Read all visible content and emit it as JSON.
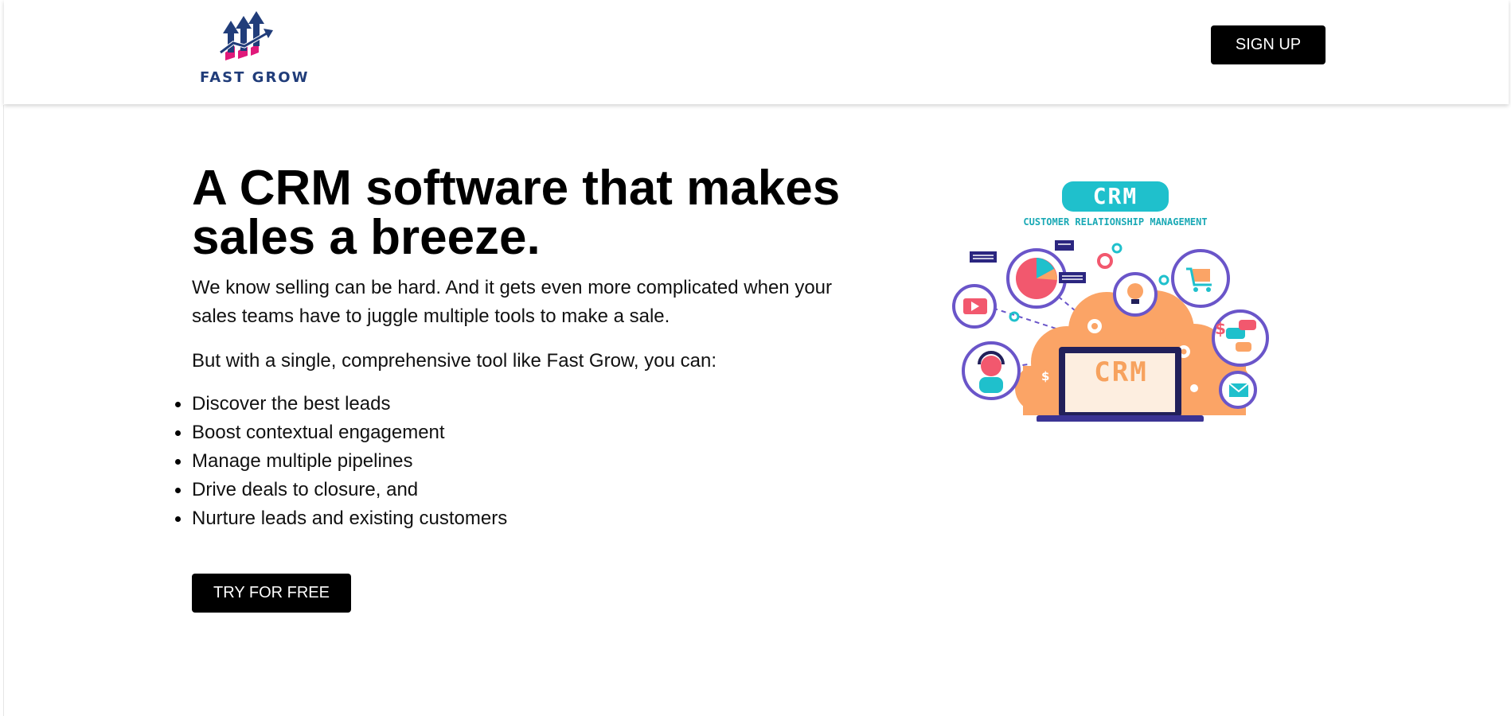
{
  "header": {
    "logo_text": "FAST GROW",
    "signup_label": "SIGN UP"
  },
  "hero": {
    "title": "A CRM software that makes sales a breeze.",
    "paragraph1": "We know selling can be hard. And it gets even more complicated when your sales teams have to juggle multiple tools to make a sale.",
    "paragraph2": "But with a single, comprehensive tool like Fast Grow, you can:",
    "features": [
      "Discover the best leads",
      "Boost contextual engagement",
      "Manage multiple pipelines",
      "Drive deals to closure, and",
      "Nurture leads and existing customers"
    ],
    "cta_label": "TRY FOR FREE"
  },
  "illustration": {
    "badge": "CRM",
    "subtitle": "CUSTOMER RELATIONSHIP MANAGEMENT",
    "screen_text": "CRM"
  },
  "colors": {
    "button_bg": "#000000",
    "button_text": "#ffffff",
    "logo_blue": "#213d7a",
    "logo_pink": "#e0197a",
    "crm_teal": "#1fc0cc",
    "cloud_orange": "#fba466",
    "circle_purple": "#6a55c9"
  },
  "icons": [
    "growth-arrows-logo-icon",
    "crm-illustration"
  ]
}
